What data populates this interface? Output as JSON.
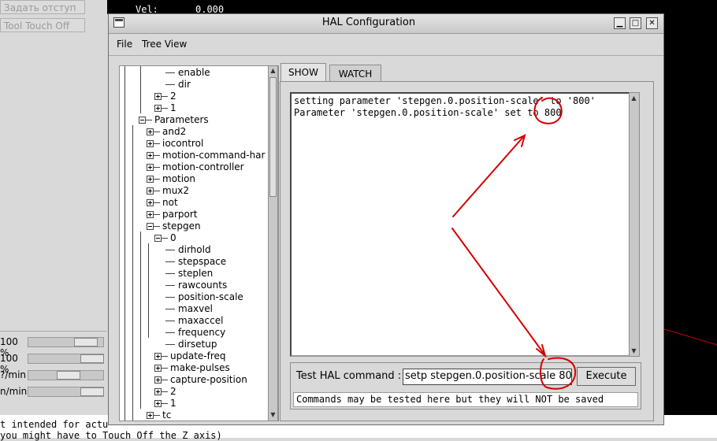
{
  "background": {
    "buttons": [
      "Задать отступ",
      "Tool Touch Off"
    ],
    "vel_label": "Vel:",
    "vel_value": "0.000",
    "top_value": "0.000",
    "sliders": [
      {
        "label": "100 %",
        "level": 0.7
      },
      {
        "label": "100 %",
        "level": 0.9
      },
      {
        "label": "?/min",
        "level": 0.4
      },
      {
        "label": "n/min",
        "level": 0.9
      }
    ],
    "messages": [
      "t intended for actu",
      "you might have to Touch Off the Z axis)"
    ]
  },
  "window": {
    "title": "HAL Configuration",
    "menu": [
      "File",
      "Tree View"
    ],
    "controls": {
      "minimize": "▁",
      "maximize": "□",
      "close": "✕"
    }
  },
  "tree": {
    "nodes": [
      {
        "label": "enable",
        "level": 3,
        "expander": "none"
      },
      {
        "label": "dir",
        "level": 3,
        "expander": "none"
      },
      {
        "label": "2",
        "level": 2,
        "expander": "plus"
      },
      {
        "label": "1",
        "level": 2,
        "expander": "plus"
      },
      {
        "label": "Parameters",
        "level": 0,
        "expander": "minus"
      },
      {
        "label": "and2",
        "level": 1,
        "expander": "plus"
      },
      {
        "label": "iocontrol",
        "level": 1,
        "expander": "plus"
      },
      {
        "label": "motion-command-har",
        "level": 1,
        "expander": "plus"
      },
      {
        "label": "motion-controller",
        "level": 1,
        "expander": "plus"
      },
      {
        "label": "motion",
        "level": 1,
        "expander": "plus"
      },
      {
        "label": "mux2",
        "level": 1,
        "expander": "plus"
      },
      {
        "label": "not",
        "level": 1,
        "expander": "plus"
      },
      {
        "label": "parport",
        "level": 1,
        "expander": "plus"
      },
      {
        "label": "stepgen",
        "level": 1,
        "expander": "minus"
      },
      {
        "label": "0",
        "level": 2,
        "expander": "minus"
      },
      {
        "label": "dirhold",
        "level": 3,
        "expander": "none"
      },
      {
        "label": "stepspace",
        "level": 3,
        "expander": "none"
      },
      {
        "label": "steplen",
        "level": 3,
        "expander": "none"
      },
      {
        "label": "rawcounts",
        "level": 3,
        "expander": "none"
      },
      {
        "label": "position-scale",
        "level": 3,
        "expander": "none"
      },
      {
        "label": "maxvel",
        "level": 3,
        "expander": "none"
      },
      {
        "label": "maxaccel",
        "level": 3,
        "expander": "none"
      },
      {
        "label": "frequency",
        "level": 3,
        "expander": "none"
      },
      {
        "label": "dirsetup",
        "level": 3,
        "expander": "none"
      },
      {
        "label": "update-freq",
        "level": 2,
        "expander": "plus"
      },
      {
        "label": "make-pulses",
        "level": 2,
        "expander": "plus"
      },
      {
        "label": "capture-position",
        "level": 2,
        "expander": "plus"
      },
      {
        "label": "2",
        "level": 2,
        "expander": "plus"
      },
      {
        "label": "1",
        "level": 2,
        "expander": "plus"
      },
      {
        "label": "tc",
        "level": 1,
        "expander": "plus"
      }
    ]
  },
  "tabs": [
    {
      "label": "SHOW",
      "active": true
    },
    {
      "label": "WATCH",
      "active": false
    }
  ],
  "output": {
    "lines": [
      "setting parameter 'stepgen.0.position-scale' to '800'",
      "Parameter 'stepgen.0.position-scale' set to 800"
    ]
  },
  "command": {
    "label": "Test HAL command :",
    "value": "setp stepgen.0.position-scale 800",
    "execute_label": "Execute",
    "note": "Commands may be tested here but they will NOT be saved"
  },
  "colors": {
    "annotation": "#d40000",
    "window_bg": "#d9d9d9",
    "screen_black": "#000000"
  }
}
